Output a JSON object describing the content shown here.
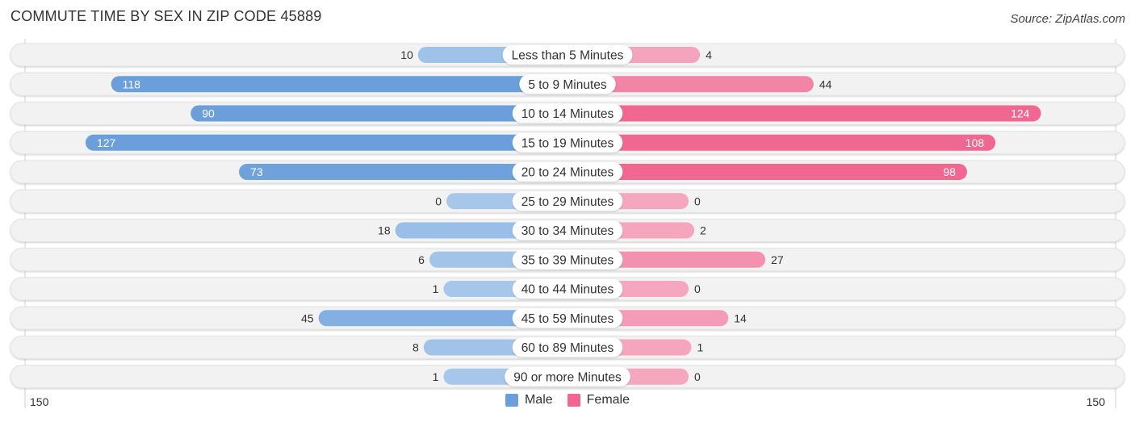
{
  "header": {
    "title": "COMMUTE TIME BY SEX IN ZIP CODE 45889",
    "source": "Source: ZipAtlas.com"
  },
  "colors": {
    "male_strong": "#6a9fdb",
    "male_light": "#a7c7ea",
    "female_strong": "#f06892",
    "female_light": "#f5a7bf",
    "track": "#f2f2f2"
  },
  "chart_data": {
    "type": "bar",
    "orientation": "horizontal-diverging",
    "title": "COMMUTE TIME BY SEX IN ZIP CODE 45889",
    "categories": [
      "Less than 5 Minutes",
      "5 to 9 Minutes",
      "10 to 14 Minutes",
      "15 to 19 Minutes",
      "20 to 24 Minutes",
      "25 to 29 Minutes",
      "30 to 34 Minutes",
      "35 to 39 Minutes",
      "40 to 44 Minutes",
      "45 to 59 Minutes",
      "60 to 89 Minutes",
      "90 or more Minutes"
    ],
    "series": [
      {
        "name": "Male",
        "side": "left",
        "values": [
          10,
          118,
          90,
          127,
          73,
          0,
          18,
          6,
          1,
          45,
          8,
          1
        ]
      },
      {
        "name": "Female",
        "side": "right",
        "values": [
          4,
          44,
          124,
          108,
          98,
          0,
          2,
          27,
          0,
          14,
          1,
          0
        ]
      }
    ],
    "axis": {
      "left_tick": "150",
      "right_tick": "150",
      "max": 150
    },
    "legend": {
      "position": "bottom-center",
      "entries": [
        "Male",
        "Female"
      ]
    },
    "grid": false
  }
}
